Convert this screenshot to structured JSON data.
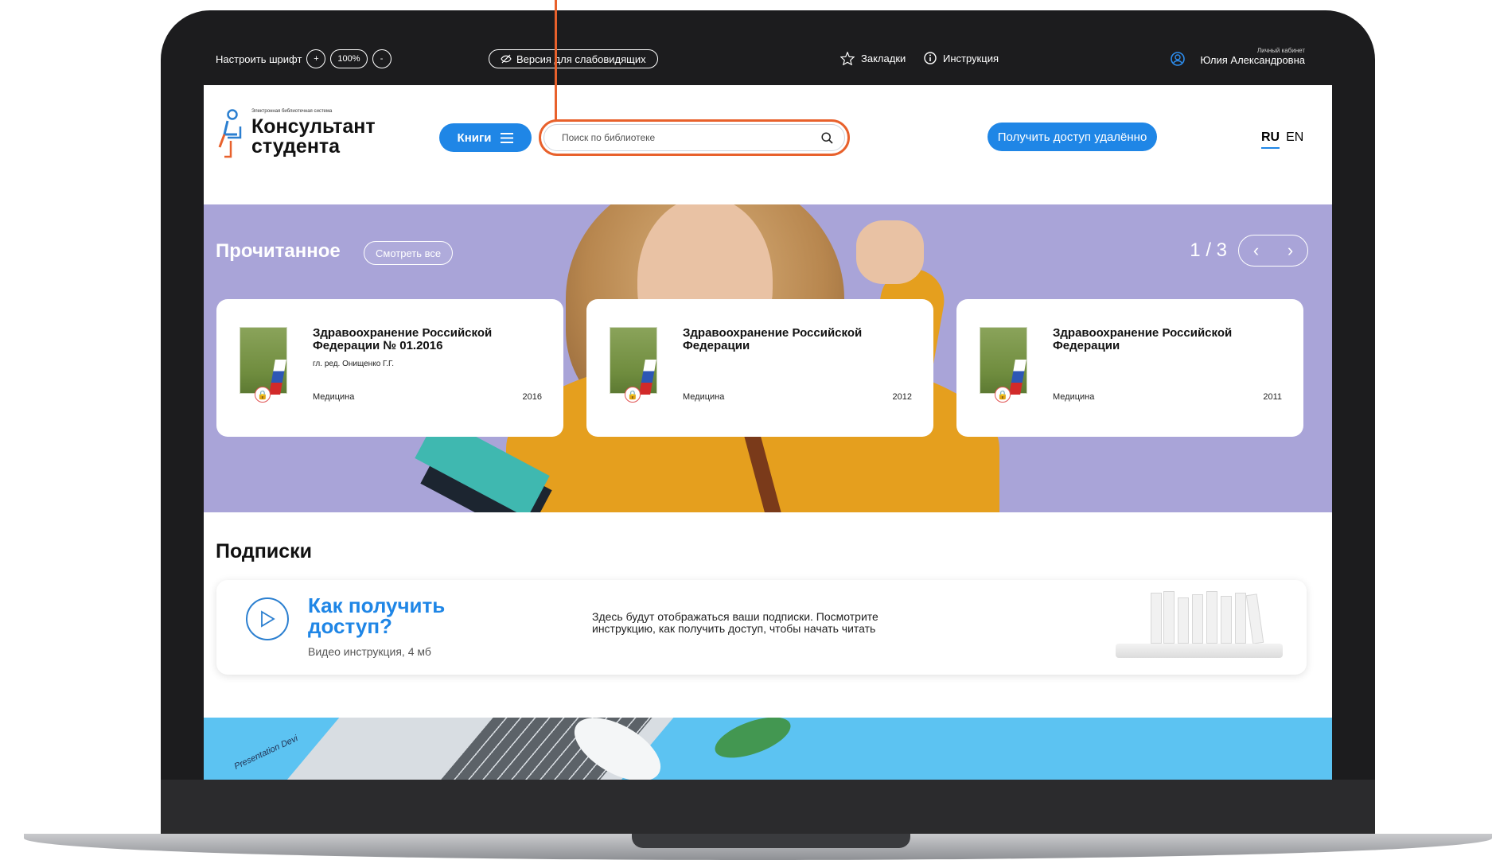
{
  "topbar": {
    "font_label": "Настроить шрифт",
    "font_plus": "+",
    "font_percent": "100%",
    "font_minus": "-",
    "low_vision": "Версия для слабовидящих",
    "bookmarks": "Закладки",
    "instruction": "Инструкция",
    "cabinet_label": "Личный кабинет",
    "user_name": "Юлия Александровна"
  },
  "header": {
    "logo_tagline": "Электронная библиотечная система",
    "logo_line1": "Консультант",
    "logo_line2": "студента",
    "books_button": "Книги",
    "search_placeholder": "Поиск по библиотеке",
    "access_button": "Получить доступ удалённо",
    "lang_ru": "RU",
    "lang_en": "EN"
  },
  "hero": {
    "title": "Прочитанное",
    "see_all": "Смотреть все",
    "pager": "1 / 3",
    "prev": "‹",
    "next": "›",
    "cards": [
      {
        "title": "Здравоохранение Российской Федерации № 01.2016",
        "author": "гл. ред. Онищенко Г.Г.",
        "subject": "Медицина",
        "year": "2016"
      },
      {
        "title": "Здравоохранение Российской Федерации",
        "author": "",
        "subject": "Медицина",
        "year": "2012"
      },
      {
        "title": "Здравоохранение Российской Федерации",
        "author": "",
        "subject": "Медицина",
        "year": "2011"
      }
    ]
  },
  "subscriptions": {
    "title": "Подписки",
    "how_title": "Как получить доступ?",
    "how_sub": "Видео инструкция, 4 мб",
    "text": "Здесь будут отображаться ваши подписки. Посмотрите инструкцию, как получить доступ, чтобы начать читать"
  },
  "banner": {
    "text": "Presentation Devi"
  },
  "colors": {
    "accent": "#1f86e6",
    "callout": "#e8612c",
    "hero_bg": "#a9a4d8"
  }
}
